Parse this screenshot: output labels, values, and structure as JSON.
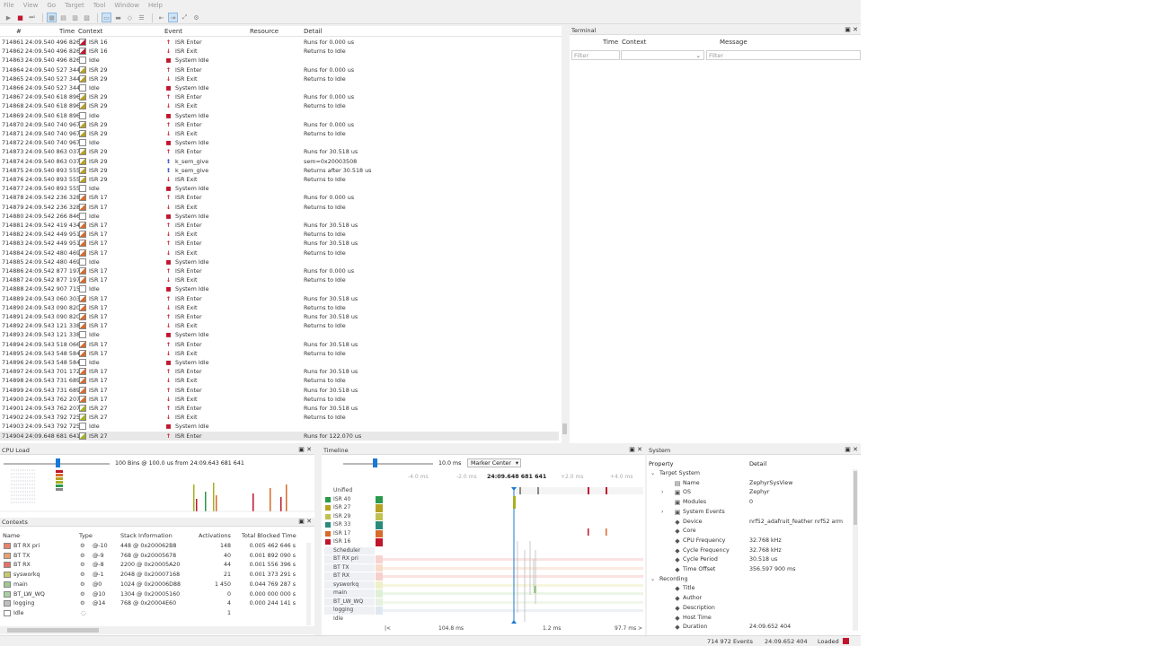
{
  "menu": [
    "File",
    "View",
    "Go",
    "Target",
    "Tool",
    "Window",
    "Help"
  ],
  "events": {
    "headers": {
      "index": "#",
      "time": "Time",
      "context": "Context",
      "event": "Event",
      "resource": "Resource",
      "detail": "Detail"
    },
    "rows": [
      {
        "i": "714861",
        "t": "24:09.540 496 826",
        "c": "ISR 16",
        "e": "ISR Enter",
        "d": "Runs for 0.000 us"
      },
      {
        "i": "714862",
        "t": "24:09.540 496 826",
        "c": "ISR 16",
        "e": "ISR Exit",
        "d": "Returns to Idle"
      },
      {
        "i": "714863",
        "t": "24:09.540 496 826",
        "c": "Idle",
        "e": "System Idle",
        "d": ""
      },
      {
        "i": "714864",
        "t": "24:09.540 527 344",
        "c": "ISR 29",
        "e": "ISR Enter",
        "d": "Runs for 0.000 us"
      },
      {
        "i": "714865",
        "t": "24:09.540 527 344",
        "c": "ISR 29",
        "e": "ISR Exit",
        "d": "Returns to Idle"
      },
      {
        "i": "714866",
        "t": "24:09.540 527 344",
        "c": "Idle",
        "e": "System Idle",
        "d": ""
      },
      {
        "i": "714867",
        "t": "24:09.540 618 896",
        "c": "ISR 29",
        "e": "ISR Enter",
        "d": "Runs for 0.000 us"
      },
      {
        "i": "714868",
        "t": "24:09.540 618 896",
        "c": "ISR 29",
        "e": "ISR Exit",
        "d": "Returns to Idle"
      },
      {
        "i": "714869",
        "t": "24:09.540 618 896",
        "c": "Idle",
        "e": "System Idle",
        "d": ""
      },
      {
        "i": "714870",
        "t": "24:09.540 740 967",
        "c": "ISR 29",
        "e": "ISR Enter",
        "d": "Runs for 0.000 us"
      },
      {
        "i": "714871",
        "t": "24:09.540 740 967",
        "c": "ISR 29",
        "e": "ISR Exit",
        "d": "Returns to Idle"
      },
      {
        "i": "714872",
        "t": "24:09.540 740 967",
        "c": "Idle",
        "e": "System Idle",
        "d": ""
      },
      {
        "i": "714873",
        "t": "24:09.540 863 037",
        "c": "ISR 29",
        "e": "ISR Enter",
        "d": "Runs for 30.518 us"
      },
      {
        "i": "714874",
        "t": "24:09.540 863 037",
        "c": "ISR 29",
        "e": "k_sem_give",
        "d": "sem=0x20003508"
      },
      {
        "i": "714875",
        "t": "24:09.540 893 555",
        "c": "ISR 29",
        "e": "k_sem_give",
        "d": "Returns after 30.518 us"
      },
      {
        "i": "714876",
        "t": "24:09.540 893 555",
        "c": "ISR 29",
        "e": "ISR Exit",
        "d": "Returns to Idle"
      },
      {
        "i": "714877",
        "t": "24:09.540 893 555",
        "c": "Idle",
        "e": "System Idle",
        "d": ""
      },
      {
        "i": "714878",
        "t": "24:09.542 236 328",
        "c": "ISR 17",
        "e": "ISR Enter",
        "d": "Runs for 0.000 us"
      },
      {
        "i": "714879",
        "t": "24:09.542 236 328",
        "c": "ISR 17",
        "e": "ISR Exit",
        "d": "Returns to Idle"
      },
      {
        "i": "714880",
        "t": "24:09.542 266 846",
        "c": "Idle",
        "e": "System Idle",
        "d": ""
      },
      {
        "i": "714881",
        "t": "24:09.542 419 434",
        "c": "ISR 17",
        "e": "ISR Enter",
        "d": "Runs for 30.518 us"
      },
      {
        "i": "714882",
        "t": "24:09.542 449 951",
        "c": "ISR 17",
        "e": "ISR Exit",
        "d": "Returns to Idle"
      },
      {
        "i": "714883",
        "t": "24:09.542 449 951",
        "c": "ISR 17",
        "e": "ISR Enter",
        "d": "Runs for 30.518 us"
      },
      {
        "i": "714884",
        "t": "24:09.542 480 469",
        "c": "ISR 17",
        "e": "ISR Exit",
        "d": "Returns to Idle"
      },
      {
        "i": "714885",
        "t": "24:09.542 480 469",
        "c": "Idle",
        "e": "System Idle",
        "d": ""
      },
      {
        "i": "714886",
        "t": "24:09.542 877 197",
        "c": "ISR 17",
        "e": "ISR Enter",
        "d": "Runs for 0.000 us"
      },
      {
        "i": "714887",
        "t": "24:09.542 877 197",
        "c": "ISR 17",
        "e": "ISR Exit",
        "d": "Returns to Idle"
      },
      {
        "i": "714888",
        "t": "24:09.542 907 715",
        "c": "Idle",
        "e": "System Idle",
        "d": ""
      },
      {
        "i": "714889",
        "t": "24:09.543 060 303",
        "c": "ISR 17",
        "e": "ISR Enter",
        "d": "Runs for 30.518 us"
      },
      {
        "i": "714890",
        "t": "24:09.543 090 820",
        "c": "ISR 17",
        "e": "ISR Exit",
        "d": "Returns to Idle"
      },
      {
        "i": "714891",
        "t": "24:09.543 090 820",
        "c": "ISR 17",
        "e": "ISR Enter",
        "d": "Runs for 30.518 us"
      },
      {
        "i": "714892",
        "t": "24:09.543 121 338",
        "c": "ISR 17",
        "e": "ISR Exit",
        "d": "Returns to Idle"
      },
      {
        "i": "714893",
        "t": "24:09.543 121 338",
        "c": "Idle",
        "e": "System Idle",
        "d": ""
      },
      {
        "i": "714894",
        "t": "24:09.543 518 066",
        "c": "ISR 17",
        "e": "ISR Enter",
        "d": "Runs for 30.518 us"
      },
      {
        "i": "714895",
        "t": "24:09.543 548 584",
        "c": "ISR 17",
        "e": "ISR Exit",
        "d": "Returns to Idle"
      },
      {
        "i": "714896",
        "t": "24:09.543 548 584",
        "c": "Idle",
        "e": "System Idle",
        "d": ""
      },
      {
        "i": "714897",
        "t": "24:09.543 701 172",
        "c": "ISR 17",
        "e": "ISR Enter",
        "d": "Runs for 30.518 us"
      },
      {
        "i": "714898",
        "t": "24:09.543 731 689",
        "c": "ISR 17",
        "e": "ISR Exit",
        "d": "Returns to Idle"
      },
      {
        "i": "714899",
        "t": "24:09.543 731 689",
        "c": "ISR 17",
        "e": "ISR Enter",
        "d": "Runs for 30.518 us"
      },
      {
        "i": "714900",
        "t": "24:09.543 762 207",
        "c": "ISR 17",
        "e": "ISR Exit",
        "d": "Returns to Idle"
      },
      {
        "i": "714901",
        "t": "24:09.543 762 207",
        "c": "ISR 27",
        "e": "ISR Enter",
        "d": "Runs for 30.518 us"
      },
      {
        "i": "714902",
        "t": "24:09.543 792 725",
        "c": "ISR 27",
        "e": "ISR Exit",
        "d": "Returns to Idle"
      },
      {
        "i": "714903",
        "t": "24:09.543 792 725",
        "c": "Idle",
        "e": "System Idle",
        "d": ""
      },
      {
        "i": "714904",
        "t": "24:09.648 681 641",
        "c": "ISR 27",
        "e": "ISR Enter",
        "d": "Runs for 122.070 us"
      }
    ]
  },
  "terminal": {
    "title": "Terminal",
    "headers": {
      "time": "Time",
      "context": "Context",
      "message": "Message"
    },
    "filter_placeholder": "Filter"
  },
  "cpu_load": {
    "title": "CPU Load",
    "summary": "100 Bins @ 100.0 us from 24:09.643 681 641"
  },
  "contexts": {
    "title": "Contexts",
    "headers": {
      "name": "Name",
      "type": "Type",
      "stack": "Stack Information",
      "activations": "Activations",
      "blocked": "Total Blocked Time"
    },
    "rows": [
      {
        "name": "BT RX pri",
        "prio": "@-10",
        "stack": "448 @ 0x200062B8",
        "act": "148",
        "blocked": "0.005 462 646 s"
      },
      {
        "name": "BT TX",
        "prio": "@-9",
        "stack": "768 @ 0x20005678",
        "act": "40",
        "blocked": "0.001 892 090 s"
      },
      {
        "name": "BT RX",
        "prio": "@-8",
        "stack": "2200 @ 0x20005A20",
        "act": "44",
        "blocked": "0.001 556 396 s"
      },
      {
        "name": "sysworkq",
        "prio": "@-1",
        "stack": "2048 @ 0x20007168",
        "act": "21",
        "blocked": "0.001 373 291 s"
      },
      {
        "name": "main",
        "prio": "@0",
        "stack": "1024 @ 0x20006D88",
        "act": "1 450",
        "blocked": "0.044 769 287 s"
      },
      {
        "name": "BT_LW_WQ",
        "prio": "@10",
        "stack": "1304 @ 0x20005160",
        "act": "0",
        "blocked": "0.000 000 000 s"
      },
      {
        "name": "logging",
        "prio": "@14",
        "stack": "768 @ 0x20004E60",
        "act": "4",
        "blocked": "0.000 244 141 s"
      },
      {
        "name": "Idle",
        "prio": "",
        "stack": "",
        "act": "1",
        "blocked": ""
      }
    ]
  },
  "timeline": {
    "title": "Timeline",
    "zoom": "10.0 ms",
    "mode": "Marker Center",
    "ticks": [
      "-4.0 ms",
      "-2.0 ms",
      "24:09.648 681 641",
      "+2.0 ms",
      "+4.0 ms"
    ],
    "lanes": [
      "Unified",
      "ISR 40",
      "ISR 27",
      "ISR 29",
      "ISR 33",
      "ISR 17",
      "ISR 16",
      "Scheduler",
      "BT RX pri",
      "BT TX",
      "BT RX",
      "sysworkq",
      "main",
      "BT_LW_WQ",
      "logging",
      "Idle"
    ],
    "bottom": {
      "left": "104.8 ms",
      "mid": "1.2 ms",
      "right": "97.7 ms"
    }
  },
  "system": {
    "title": "System",
    "headers": {
      "property": "Property",
      "detail": "Detail"
    },
    "rows": [
      {
        "lvl": 0,
        "exp": "v",
        "ico": "",
        "k": "Target System",
        "v": ""
      },
      {
        "lvl": 1,
        "exp": "",
        "ico": "▤",
        "k": "Name",
        "v": "ZephyrSysView"
      },
      {
        "lvl": 1,
        "exp": ">",
        "ico": "▣",
        "k": "OS",
        "v": "Zephyr"
      },
      {
        "lvl": 1,
        "exp": "",
        "ico": "▣",
        "k": "Modules",
        "v": "0"
      },
      {
        "lvl": 1,
        "exp": ">",
        "ico": "▣",
        "k": "System Events",
        "v": ""
      },
      {
        "lvl": 1,
        "exp": "",
        "ico": "◆",
        "k": "Device",
        "v": "nrf52_adafruit_feather nrf52 arm"
      },
      {
        "lvl": 1,
        "exp": "",
        "ico": "◆",
        "k": "Core",
        "v": ""
      },
      {
        "lvl": 1,
        "exp": "",
        "ico": "◆",
        "k": "CPU Frequency",
        "v": "32.768 kHz"
      },
      {
        "lvl": 1,
        "exp": "",
        "ico": "◆",
        "k": "Cycle Frequency",
        "v": "32.768 kHz"
      },
      {
        "lvl": 1,
        "exp": "",
        "ico": "◆",
        "k": "Cycle Period",
        "v": "30.518 us"
      },
      {
        "lvl": 1,
        "exp": "",
        "ico": "◆",
        "k": "Time Offset",
        "v": "356.597 900 ms"
      },
      {
        "lvl": 0,
        "exp": "v",
        "ico": "",
        "k": "Recording",
        "v": ""
      },
      {
        "lvl": 1,
        "exp": "",
        "ico": "◆",
        "k": "Title",
        "v": ""
      },
      {
        "lvl": 1,
        "exp": "",
        "ico": "◆",
        "k": "Author",
        "v": ""
      },
      {
        "lvl": 1,
        "exp": "",
        "ico": "◆",
        "k": "Description",
        "v": ""
      },
      {
        "lvl": 1,
        "exp": "",
        "ico": "◆",
        "k": "Host Time",
        "v": ""
      },
      {
        "lvl": 1,
        "exp": "",
        "ico": "◆",
        "k": "Duration",
        "v": "24:09.652 404"
      }
    ]
  },
  "status": {
    "events": "714 972 Events",
    "time": "24:09.652 404",
    "loaded": "Loaded"
  },
  "colors": {
    "isr16": "#c0152d",
    "isr29": "#b8a020",
    "isr17": "#d86a2a",
    "isr27": "#a8b020",
    "idle": "#ffffff",
    "select_blue": "#1a78d6"
  }
}
